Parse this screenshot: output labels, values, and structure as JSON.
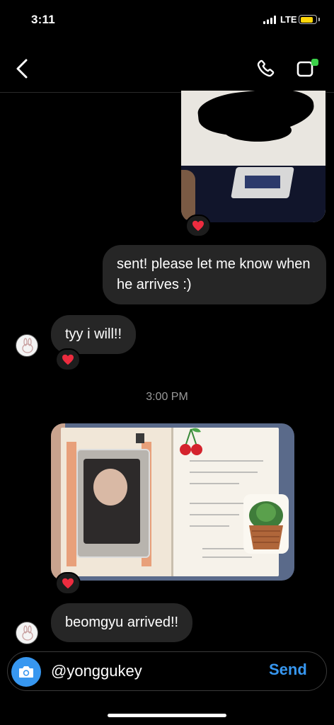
{
  "status": {
    "time": "3:11",
    "network": "LTE",
    "battery_color": "#ffd60a"
  },
  "header": {
    "back_icon": "chevron-left-icon",
    "call_icon": "phone-icon",
    "video_icon": "video-camera-icon"
  },
  "messages": [
    {
      "from": "me",
      "type": "photo",
      "reaction": "❤️"
    },
    {
      "from": "me",
      "type": "text",
      "text": "sent! please let me know when he arrives :)"
    },
    {
      "from": "them",
      "type": "text",
      "text": "tyy i will!!",
      "reaction": "❤️"
    },
    {
      "type": "timestamp",
      "text": "3:00 PM"
    },
    {
      "from": "them",
      "type": "photo",
      "reaction": "❤️"
    },
    {
      "from": "them",
      "type": "text",
      "text": "beomgyu arrived!!"
    }
  ],
  "composer": {
    "value": "@yonggukey",
    "send_label": "Send",
    "accent_color": "#3797f0"
  }
}
